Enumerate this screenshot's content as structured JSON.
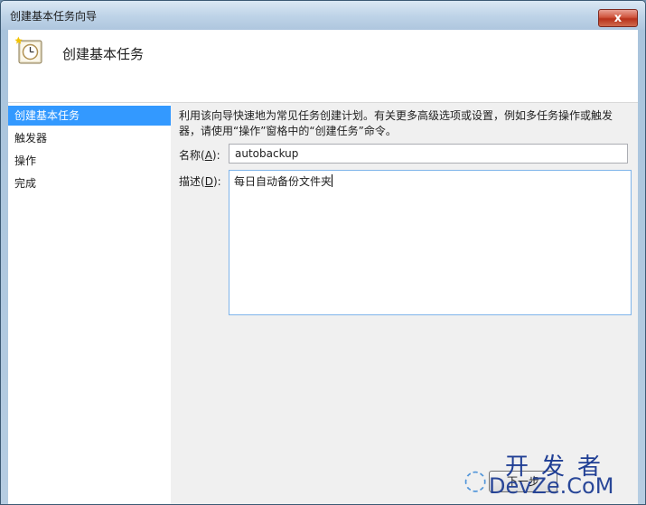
{
  "window": {
    "title": "创建基本任务向导",
    "close_glyph": "x"
  },
  "header": {
    "title": "创建基本任务",
    "icon": "task-scheduler-clock-icon"
  },
  "sidebar": {
    "items": [
      {
        "label": "创建基本任务",
        "active": true
      },
      {
        "label": "触发器",
        "active": false
      },
      {
        "label": "操作",
        "active": false
      },
      {
        "label": "完成",
        "active": false
      }
    ]
  },
  "form": {
    "intro": "利用该向导快速地为常见任务创建计划。有关更多高级选项或设置，例如多任务操作或触发器，请使用“操作”窗格中的“创建任务”命令。",
    "name_label": "名称(",
    "name_key": "A",
    "name_label_end": "):",
    "name_value": "autobackup",
    "desc_label": "描述(",
    "desc_key": "D",
    "desc_label_end": "):",
    "desc_value": "每日自动备份文件夹"
  },
  "footer": {
    "next_button": "下一步"
  },
  "watermark": {
    "line1": "开发者",
    "line2": "DevZe.CoM"
  },
  "colors": {
    "accent": "#3399ff",
    "close": "#c8432b"
  }
}
